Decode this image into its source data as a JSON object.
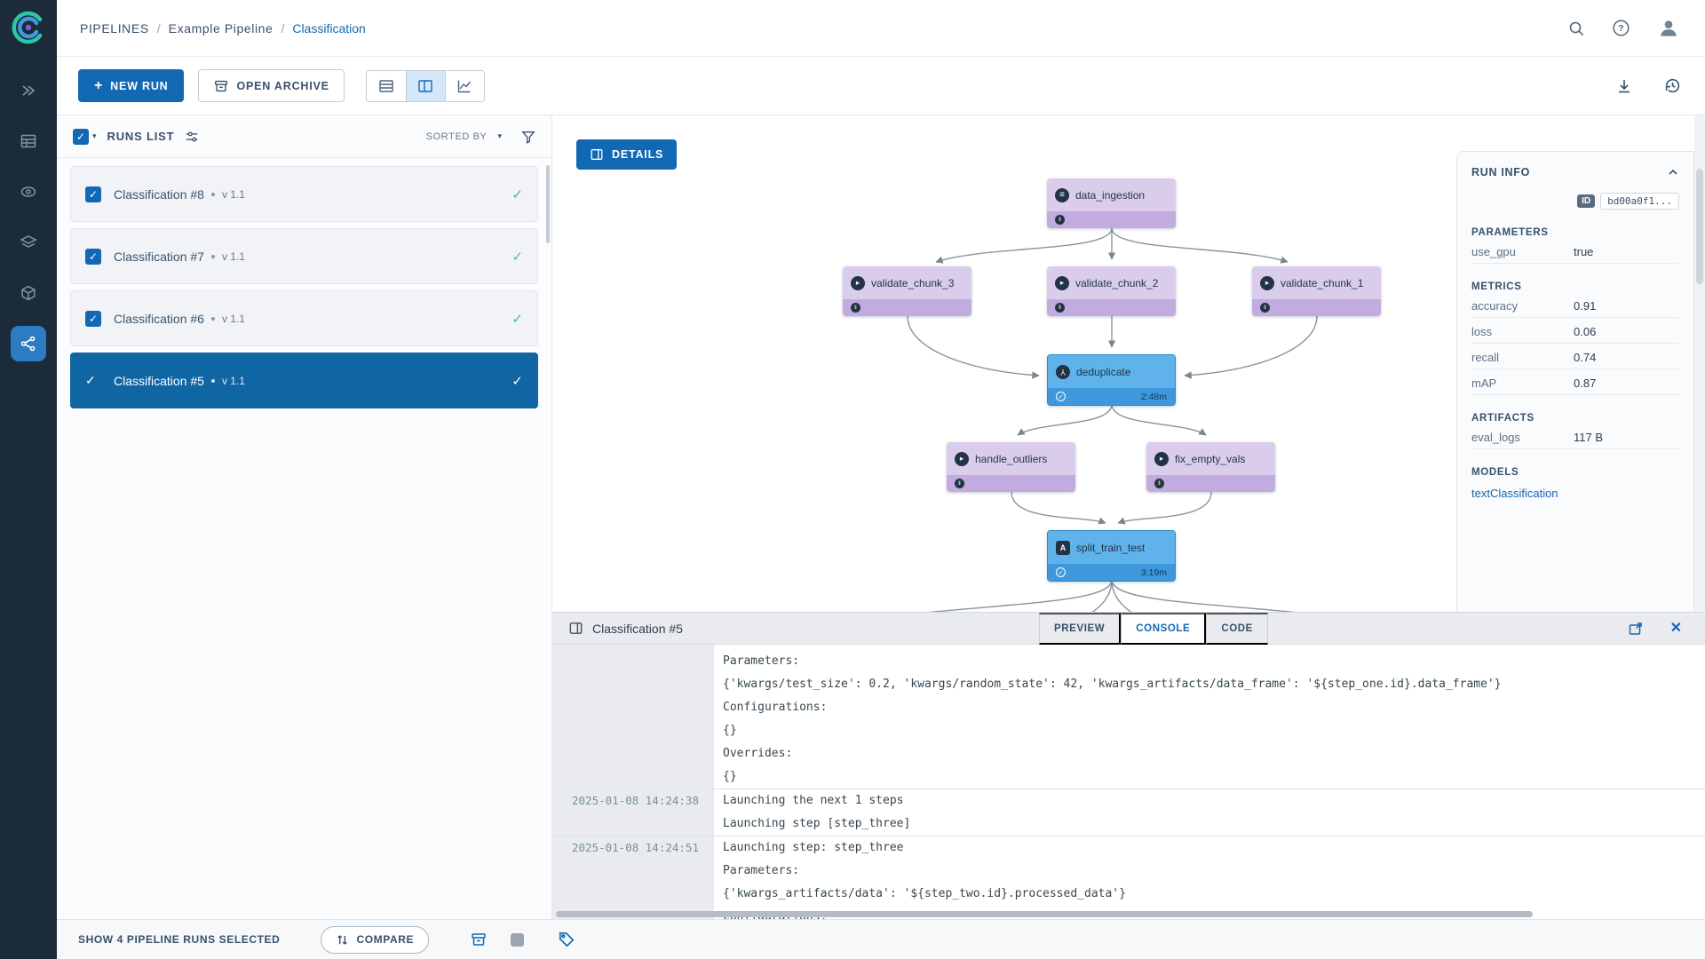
{
  "breadcrumb": {
    "root": "PIPELINES",
    "sep": "/",
    "project": "Example Pipeline",
    "current": "Classification"
  },
  "toolbar": {
    "new_run": "NEW RUN",
    "open_archive": "OPEN ARCHIVE"
  },
  "runs_panel": {
    "title": "RUNS LIST",
    "sorted_by": "SORTED BY",
    "items": [
      {
        "title": "Classification #8",
        "version": "v 1.1",
        "checked": true,
        "selected": false
      },
      {
        "title": "Classification #7",
        "version": "v 1.1",
        "checked": true,
        "selected": false
      },
      {
        "title": "Classification #6",
        "version": "v 1.1",
        "checked": true,
        "selected": false
      },
      {
        "title": "Classification #5",
        "version": "v 1.1",
        "checked": true,
        "selected": true
      }
    ]
  },
  "graph": {
    "details": "DETAILS",
    "nodes": [
      {
        "label": "data_ingestion",
        "icon": "database-icon",
        "state": "pending"
      },
      {
        "label": "validate_chunk_3",
        "icon": "run-icon",
        "state": "pending"
      },
      {
        "label": "validate_chunk_2",
        "icon": "run-icon",
        "state": "pending"
      },
      {
        "label": "validate_chunk_1",
        "icon": "run-icon",
        "state": "pending"
      },
      {
        "label": "deduplicate",
        "icon": "branch-icon",
        "state": "completed",
        "duration": "2:48m"
      },
      {
        "label": "handle_outliers",
        "icon": "run-icon",
        "state": "pending"
      },
      {
        "label": "fix_empty_vals",
        "icon": "run-icon",
        "state": "pending"
      },
      {
        "label": "split_train_test",
        "icon": "code-icon",
        "state": "completed",
        "duration": "3:19m"
      }
    ]
  },
  "run_info": {
    "title": "RUN INFO",
    "id_label": "ID",
    "id_value": "bd00a0f1...",
    "parameters_title": "PARAMETERS",
    "parameters": [
      {
        "label": "use_gpu",
        "value": "true"
      }
    ],
    "metrics_title": "METRICS",
    "metrics": [
      {
        "label": "accuracy",
        "value": "0.91"
      },
      {
        "label": "loss",
        "value": "0.06"
      },
      {
        "label": "recall",
        "value": "0.74"
      },
      {
        "label": "mAP",
        "value": "0.87"
      }
    ],
    "artifacts_title": "ARTIFACTS",
    "artifacts": [
      {
        "label": "eval_logs",
        "value": "117 B"
      }
    ],
    "models_title": "MODELS",
    "model_link": "textClassification"
  },
  "console": {
    "title": "Classification #5",
    "tabs": {
      "preview": "PREVIEW",
      "console": "CONSOLE",
      "code": "CODE"
    },
    "active_tab": "CONSOLE",
    "entries": [
      {
        "timestamp": "",
        "lines": [
          "Parameters:",
          "{'kwargs/test_size': 0.2, 'kwargs/random_state': 42, 'kwargs_artifacts/data_frame': '${step_one.id}.data_frame'}",
          "Configurations:",
          "{}",
          "Overrides:",
          "{}"
        ]
      },
      {
        "timestamp": "2025-01-08 14:24:38",
        "lines": [
          "Launching the next 1 steps",
          "Launching step [step_three]"
        ]
      },
      {
        "timestamp": "2025-01-08 14:24:51",
        "lines": [
          "Launching step: step_three",
          "Parameters:",
          "{'kwargs_artifacts/data': '${step_two.id}.processed_data'}",
          "Configurations:"
        ]
      }
    ]
  },
  "footer": {
    "selection": "SHOW 4 PIPELINE RUNS SELECTED",
    "compare": "COMPARE"
  },
  "colors": {
    "accent": "#1268b3",
    "selected_run": "#1065a3",
    "sidebar": "#1c2b3a",
    "node_purple": "#dacdec",
    "node_purple_footer": "#c2abde",
    "node_blue": "#60b2eb",
    "node_blue_footer": "#3e98db",
    "status_check": "#45b5b5"
  }
}
